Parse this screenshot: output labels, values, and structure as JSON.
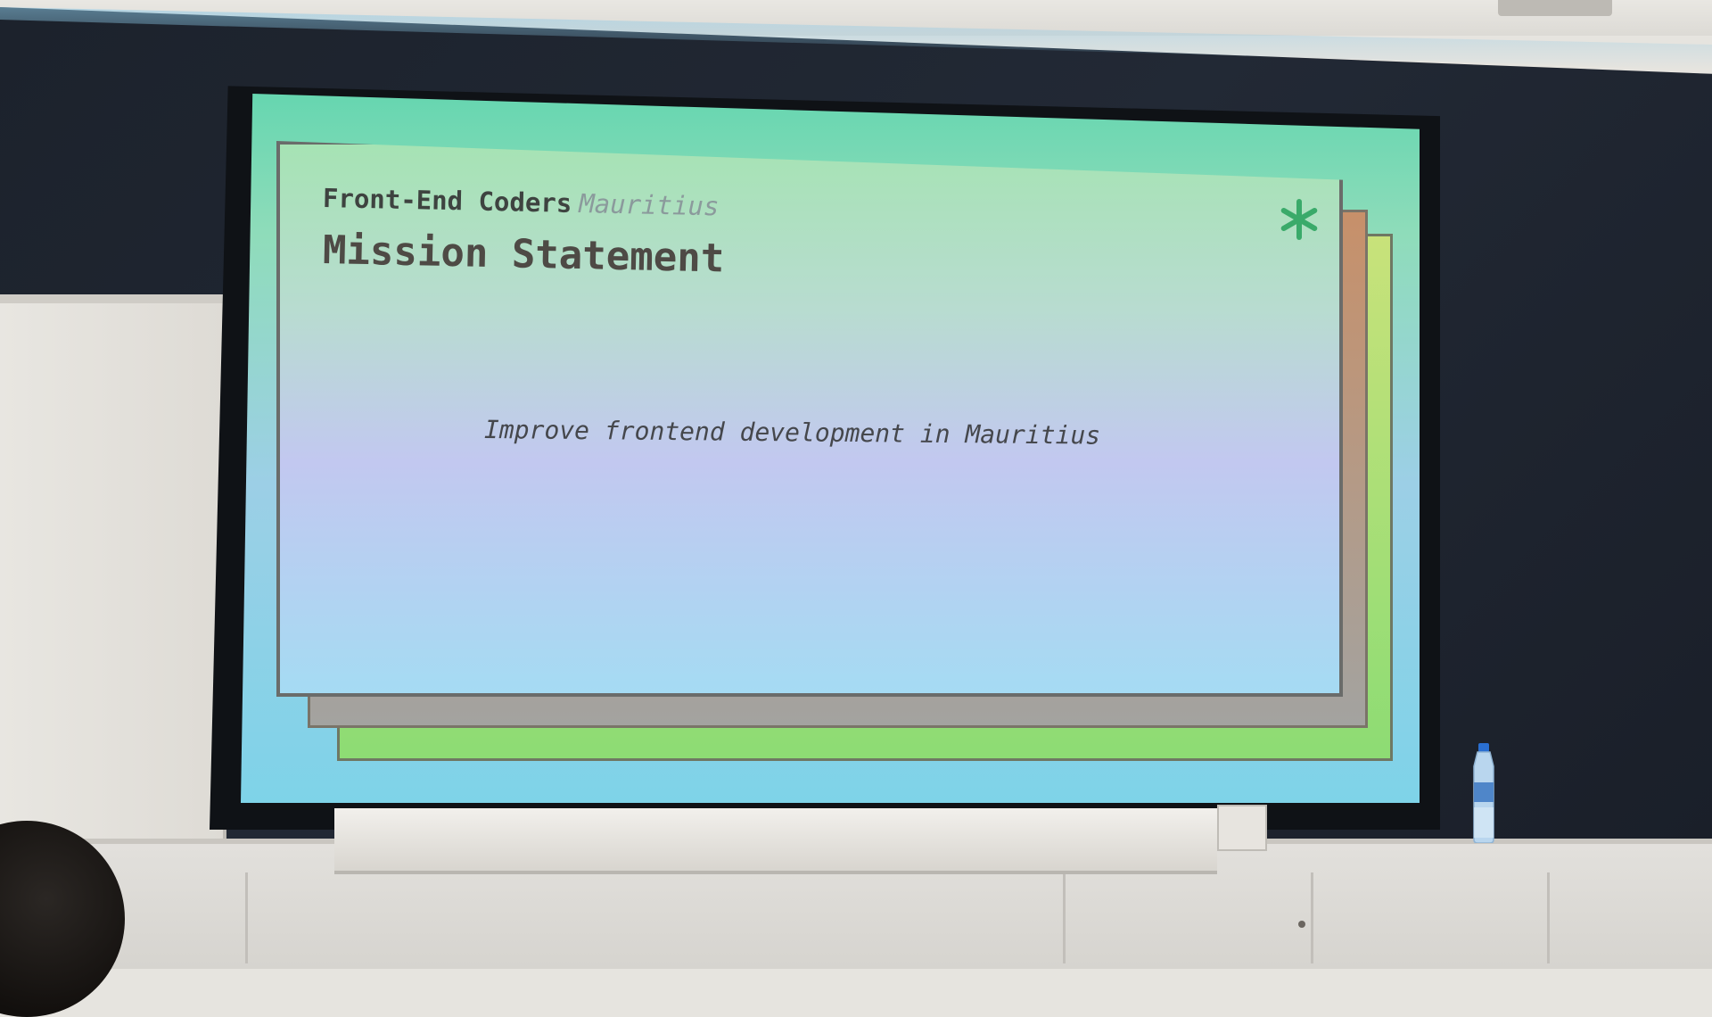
{
  "slide": {
    "org_name": "Front-End Coders",
    "org_place": "Mauritius",
    "title": "Mission Statement",
    "body": "Improve frontend development in Mauritius",
    "corner_icon": "asterisk-icon"
  },
  "colors": {
    "screen_bg_top": "#66d6b0",
    "screen_bg_bottom": "#7ed3e8",
    "card_top": "#a6e3b4",
    "card_middle": "#c2c8f0",
    "card_bottom": "#a5dbf3",
    "accent_brown": "#c7906a",
    "accent_green": "#8ddc74",
    "icon_green": "#3aaa6a",
    "title_text": "#4e4a45"
  }
}
